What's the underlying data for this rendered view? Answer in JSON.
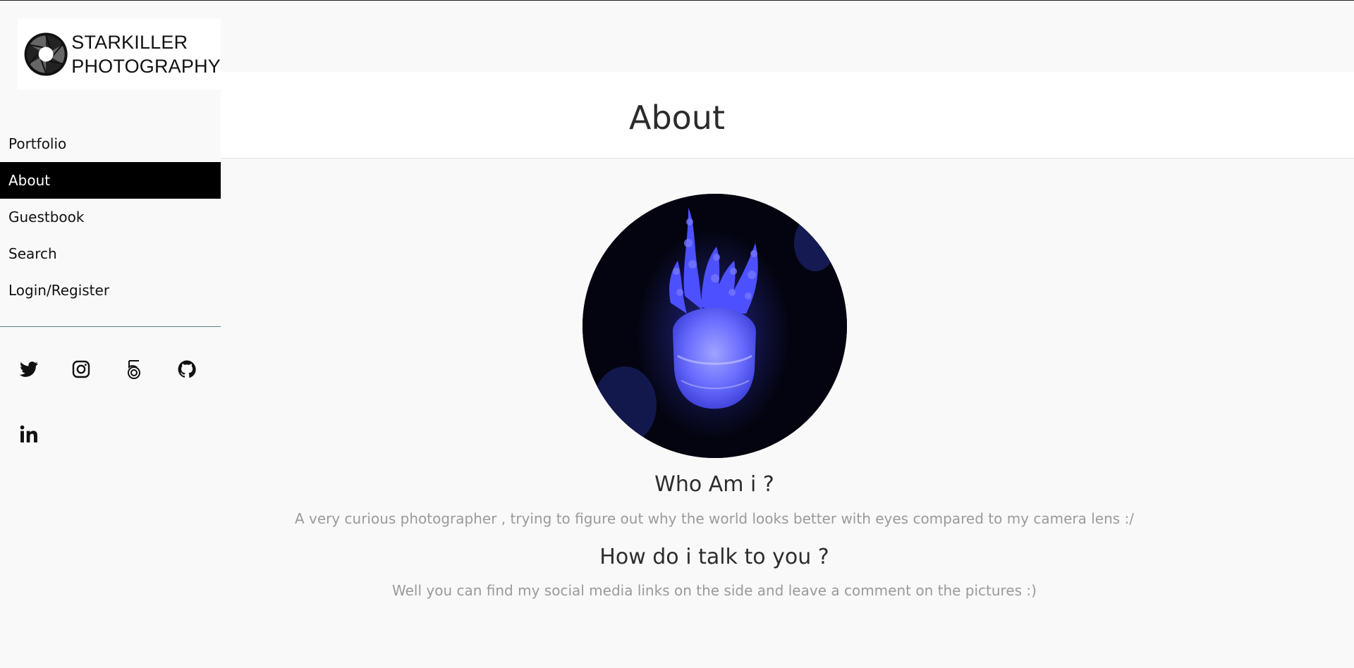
{
  "logo": {
    "line1": "STARKILLER",
    "line2": "PHOTOGRAPHY",
    "icon": "camera-aperture-icon"
  },
  "nav": {
    "items": [
      {
        "label": "Portfolio"
      },
      {
        "label": "About"
      },
      {
        "label": "Guestbook"
      },
      {
        "label": "Search"
      },
      {
        "label": "Login/Register"
      }
    ],
    "active": "About"
  },
  "social": [
    {
      "icon": "twitter-icon"
    },
    {
      "icon": "instagram-icon"
    },
    {
      "icon": "500px-icon"
    },
    {
      "icon": "github-icon"
    },
    {
      "icon": "linkedin-icon"
    }
  ],
  "page": {
    "title": "About"
  },
  "profile": {
    "image": "jellyfish-avatar"
  },
  "sections": [
    {
      "heading": "Who Am i ?",
      "text": "A very curious photographer , trying to figure out why the world looks better with eyes compared to my camera lens :/"
    },
    {
      "heading": "How do i talk to you ?",
      "text": "Well you can find my social media links on the side and leave a comment on the pictures :)"
    }
  ],
  "colors": {
    "active_nav_bg": "#000000",
    "active_nav_text": "#ffffff",
    "background": "#f9f9f9",
    "jellyfish": "#4a4cff"
  }
}
